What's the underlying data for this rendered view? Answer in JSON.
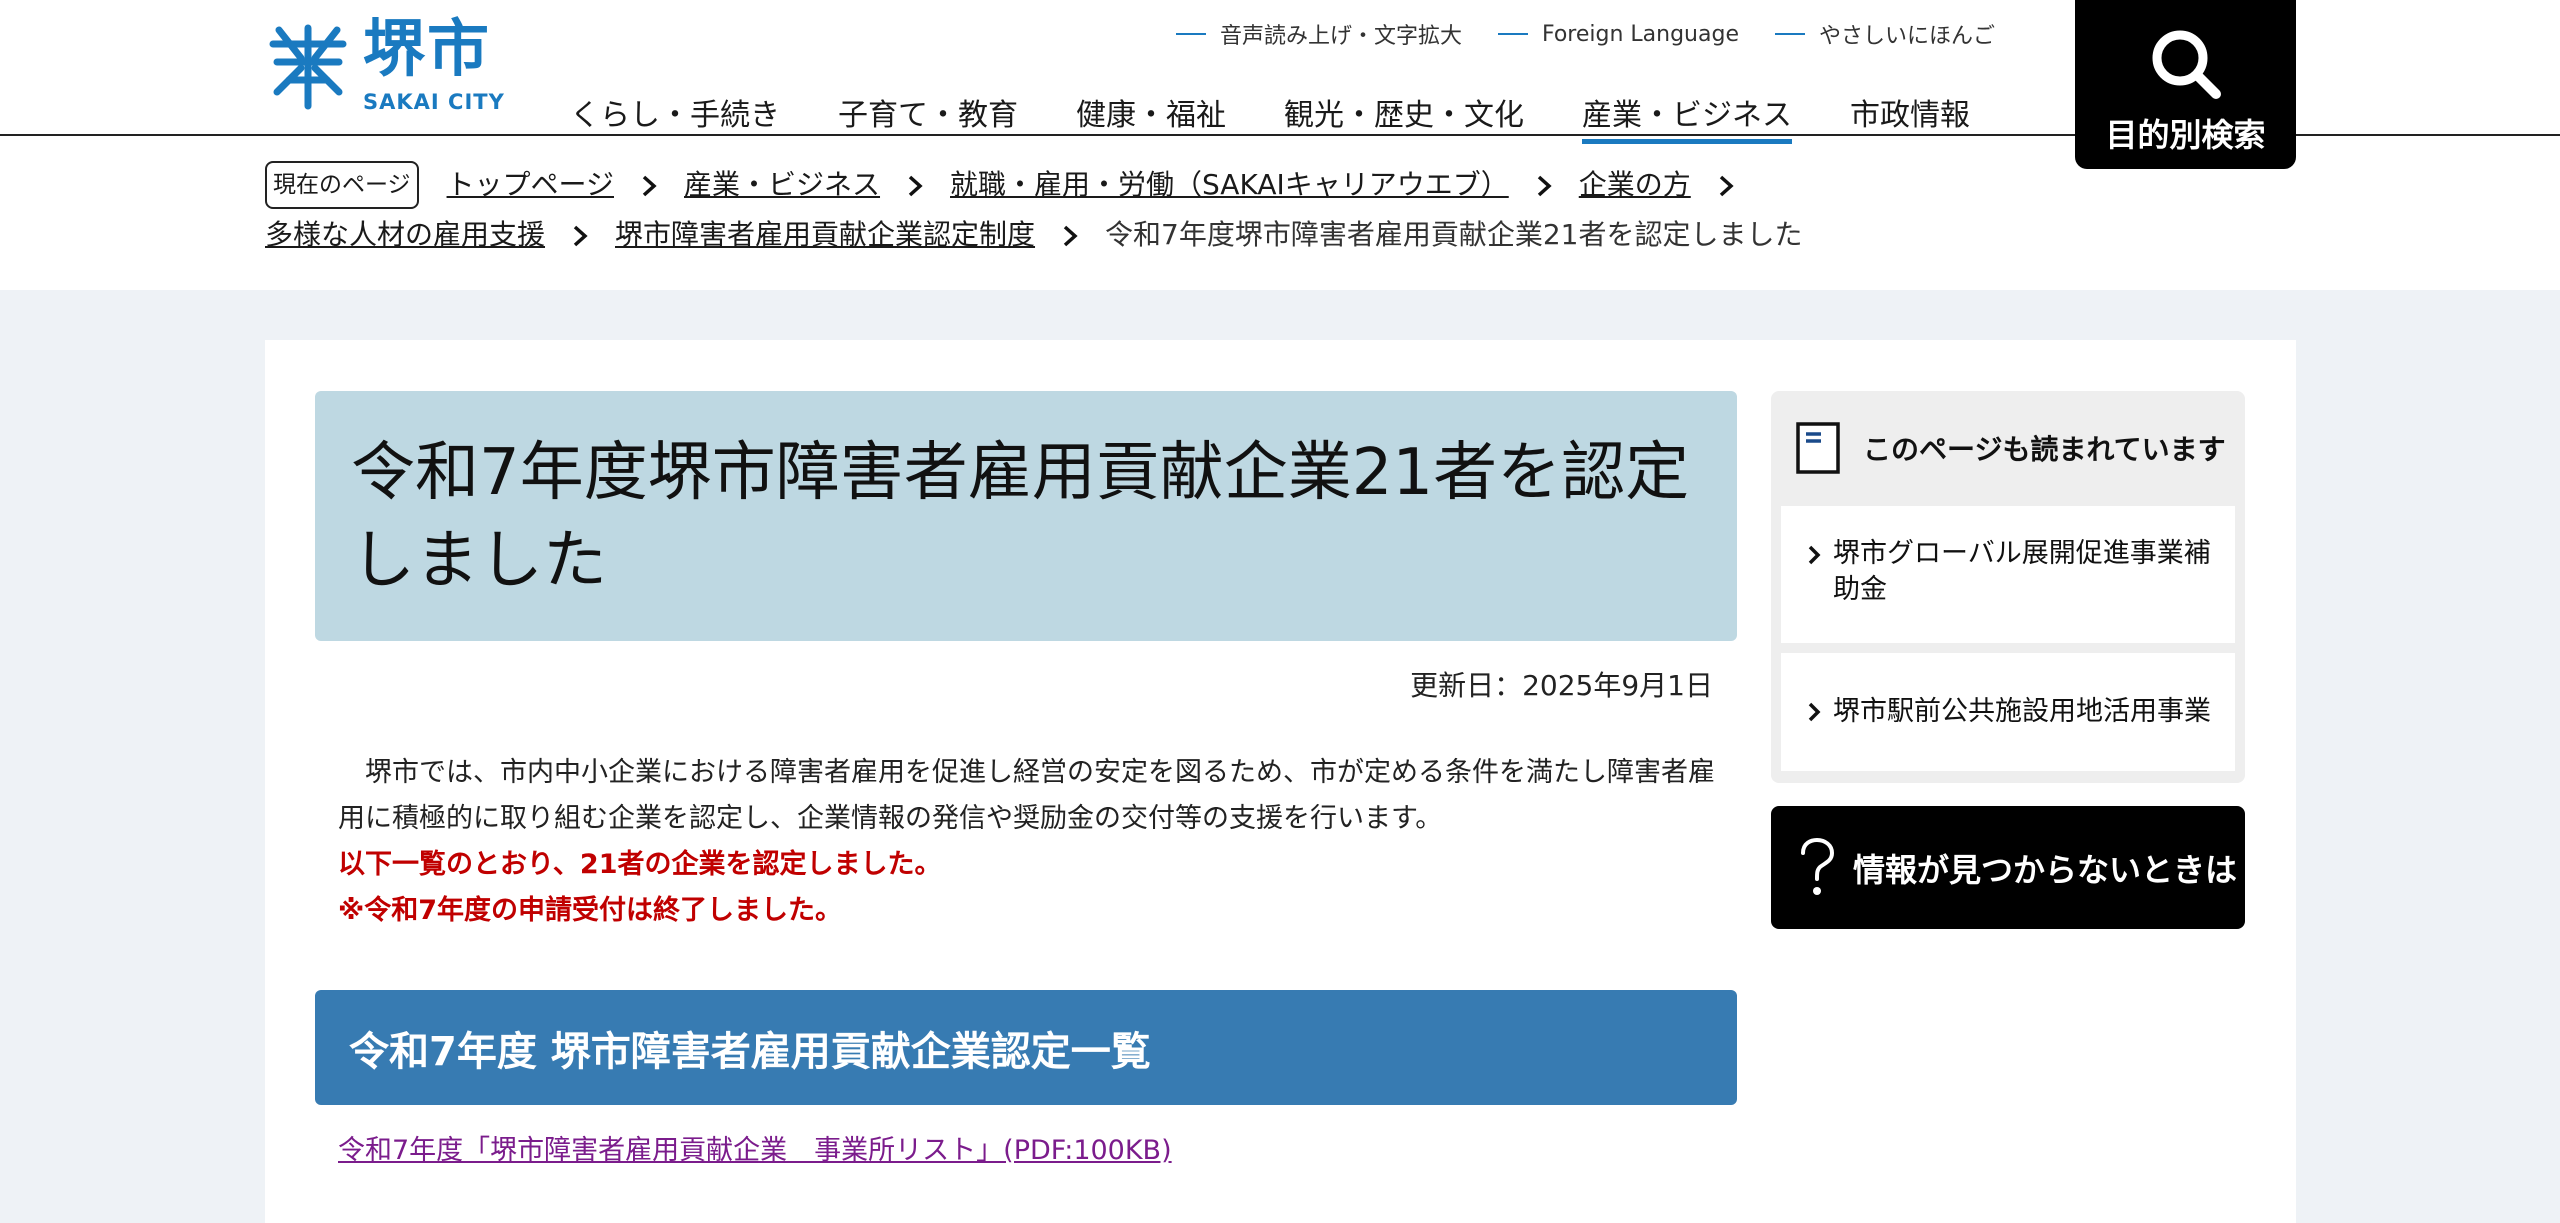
{
  "header": {
    "logo_text": "堺市",
    "logo_sub": "SAKAI CITY",
    "util_links": [
      "音声読み上げ・文字拡大",
      "Foreign Language",
      "やさしいにほんご"
    ],
    "nav": [
      "くらし・手続き",
      "子育て・教育",
      "健康・福祉",
      "観光・歴史・文化",
      "産業・ビジネス",
      "市政情報"
    ],
    "active_nav": "産業・ビジネス",
    "search_label": "目的別検索"
  },
  "breadcrumb": {
    "label": "現在のページ",
    "items": [
      "トップページ",
      "産業・ビジネス",
      "就職・雇用・労働（SAKAIキャリアウエブ）",
      "企業の方",
      "多様な人材の雇用支援",
      "堺市障害者雇用貢献企業認定制度"
    ],
    "current": "令和7年度堺市障害者雇用貢献企業21者を認定しました"
  },
  "main": {
    "title": "令和7年度堺市障害者雇用貢献企業21者を認定しました",
    "updated": "更新日：2025年9月1日",
    "intro": "　堺市では、市内中小企業における障害者雇用を促進し経営の安定を図るため、市が定める条件を満たし障害者雇用に積極的に取り組む企業を認定し、企業情報の発信や奨励金の交付等の支援を行います。",
    "notice_1": "以下一覧のとおり、21者の企業を認定しました。",
    "notice_2": "※令和7年度の申請受付は終了しました。",
    "section_heading": "令和7年度 堺市障害者雇用貢献企業認定一覧",
    "pdf_link": "令和7年度「堺市障害者雇用貢献企業　事業所リスト」(PDF:100KB)"
  },
  "side": {
    "heading": "このページも読まれています",
    "items": [
      "堺市グローバル展開促進事業補助金",
      "堺市駅前公共施設用地活用事業"
    ],
    "help_label": "情報が見つからないときは"
  },
  "colors": {
    "brand_blue": "#1a7ac0",
    "title_bg": "#bed8e2",
    "section_bg": "#377bb2",
    "notice_red": "#c00000",
    "link_purple": "#7b1c8c"
  },
  "icons": [
    "sakai-logo-icon",
    "search-icon",
    "chevron-right-icon",
    "document-icon",
    "question-icon"
  ]
}
